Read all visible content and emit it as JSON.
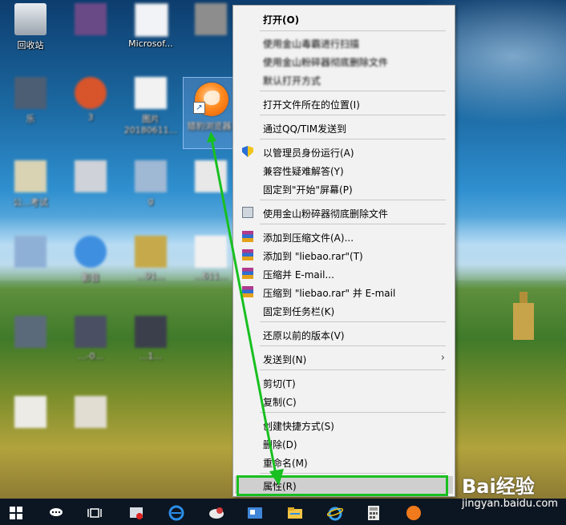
{
  "desktop": {
    "icons": [
      {
        "label": "回收站"
      },
      {
        "label": ""
      },
      {
        "label": "Microsof..."
      },
      {
        "label": ""
      },
      {
        "label": ""
      },
      {
        "label": "乐"
      },
      {
        "label": "3"
      },
      {
        "label": "图片 20180611..."
      },
      {
        "label": "猎豹浏览器"
      },
      {
        "label": "公...考试"
      },
      {
        "label": ""
      },
      {
        "label": "g"
      },
      {
        "label": ""
      },
      {
        "label": ""
      },
      {
        "label": "影音"
      },
      {
        "label": "...91..."
      },
      {
        "label": "...611..."
      },
      {
        "label": ""
      },
      {
        "label": "...-0..."
      },
      {
        "label": ""
      },
      {
        "label": ""
      },
      {
        "label": "...1..."
      }
    ]
  },
  "context_menu": {
    "items": [
      {
        "label": "打开(O)"
      },
      {
        "label": "使用金山毒霸进行扫描"
      },
      {
        "label": "使用金山粉碎器彻底删除文件"
      },
      {
        "label": "默认打开方式"
      },
      {
        "label": "打开文件所在的位置(I)"
      },
      {
        "label": "通过QQ/TIM发送到"
      },
      {
        "label": "以管理员身份运行(A)"
      },
      {
        "label": "兼容性疑难解答(Y)"
      },
      {
        "label": "固定到\"开始\"屏幕(P)"
      },
      {
        "label": "使用金山粉碎器彻底删除文件"
      },
      {
        "label": "添加到压缩文件(A)..."
      },
      {
        "label": "添加到 \"liebao.rar\"(T)"
      },
      {
        "label": "压缩并 E-mail..."
      },
      {
        "label": "压缩到 \"liebao.rar\" 并 E-mail"
      },
      {
        "label": "固定到任务栏(K)"
      },
      {
        "label": "还原以前的版本(V)"
      },
      {
        "label": "发送到(N)"
      },
      {
        "label": "剪切(T)"
      },
      {
        "label": "复制(C)"
      },
      {
        "label": "创建快捷方式(S)"
      },
      {
        "label": "删除(D)"
      },
      {
        "label": "重命名(M)"
      },
      {
        "label": "属性(R)"
      }
    ],
    "submenu_chevron": "›",
    "highlight_color": "#18c020",
    "arrow_color": "#18c020"
  },
  "taskbar": {
    "start_icon": "windows-logo-icon",
    "search_icon": "search-icon",
    "task_view_icon": "task-view-icon"
  },
  "watermark": {
    "brand": "Bai经验",
    "url": "jingyan.baidu.com"
  },
  "colors": {
    "menu_bg": "#f2f2f2",
    "selected_item_bg": "#cfcfcf",
    "taskbar_bg": "#0c1622",
    "highlight_green": "#18c020"
  }
}
